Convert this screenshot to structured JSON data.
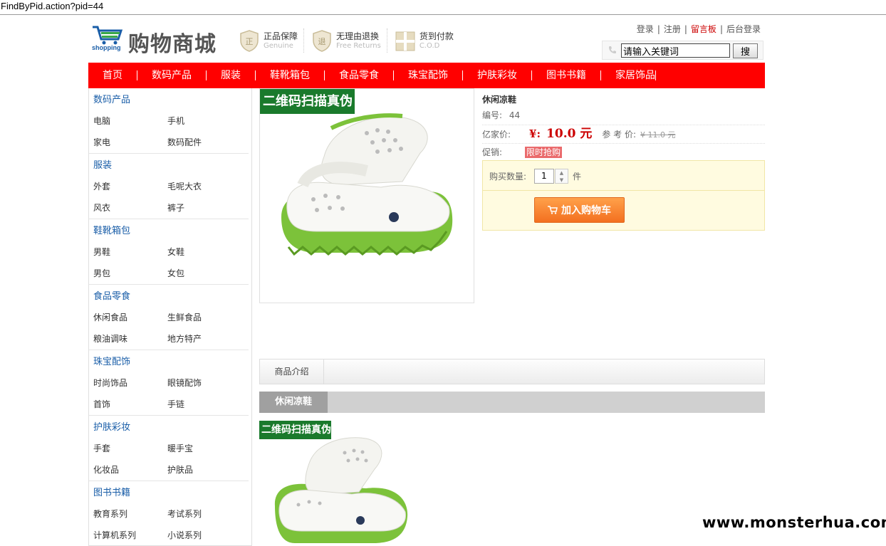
{
  "url": "FindByPid.action?pid=44",
  "logo": {
    "text": "购物商城",
    "sub": "shopping"
  },
  "guarantees": [
    {
      "title": "正品保障",
      "sub": "Genuine",
      "icon": "shield-icon"
    },
    {
      "title": "无理由退换",
      "sub": "Free Returns",
      "icon": "return-shield-icon"
    },
    {
      "title": "货到付款",
      "sub": "C.O.D",
      "icon": "gift-box-icon"
    }
  ],
  "toplinks": {
    "login": "登录",
    "register": "注册",
    "guestbook": "留言板",
    "admin": "后台登录"
  },
  "search": {
    "value": "请输入关键词",
    "button": "搜"
  },
  "nav": [
    "首页",
    "数码产品",
    "服装",
    "鞋靴箱包",
    "食品零食",
    "珠宝配饰",
    "护肤彩妆",
    "图书书籍",
    "家居饰品"
  ],
  "categories": [
    {
      "title": "数码产品",
      "items": [
        [
          "电脑",
          "手机"
        ],
        [
          "家电",
          "数码配件"
        ]
      ]
    },
    {
      "title": "服装",
      "items": [
        [
          "外套",
          "毛呢大衣"
        ],
        [
          "风衣",
          "裤子"
        ]
      ]
    },
    {
      "title": "鞋靴箱包",
      "items": [
        [
          "男鞋",
          "女鞋"
        ],
        [
          "男包",
          "女包"
        ]
      ]
    },
    {
      "title": "食品零食",
      "items": [
        [
          "休闲食品",
          "生鲜食品"
        ],
        [
          "粮油调味",
          "地方特产"
        ]
      ]
    },
    {
      "title": "珠宝配饰",
      "items": [
        [
          "时尚饰品",
          "眼镜配饰"
        ],
        [
          "首饰",
          "手链"
        ]
      ]
    },
    {
      "title": "护肤彩妆",
      "items": [
        [
          "手套",
          "暖手宝"
        ],
        [
          "化妆品",
          "护肤品"
        ]
      ]
    },
    {
      "title": "图书书籍",
      "items": [
        [
          "教育系列",
          "考试系列"
        ],
        [
          "计算机系列",
          "小说系列"
        ]
      ]
    }
  ],
  "product": {
    "badge": "二维码扫描真伪",
    "name": "休闲凉鞋",
    "code_label": "编号:",
    "code": "44",
    "price_label": "亿家价:",
    "currency": "¥:",
    "price": "10.0 元",
    "ref_label": "参 考 价:",
    "ref_price": "¥ 11.0 元",
    "promo_label": "促销:",
    "promo": "限时抢购",
    "qty_label": "购买数量:",
    "qty": "1",
    "qty_unit": "件",
    "add_to_cart": "加入购物车"
  },
  "tabs": {
    "intro": "商品介绍"
  },
  "description": {
    "title": "休闲凉鞋"
  },
  "watermark": "www.monsterhua.com"
}
